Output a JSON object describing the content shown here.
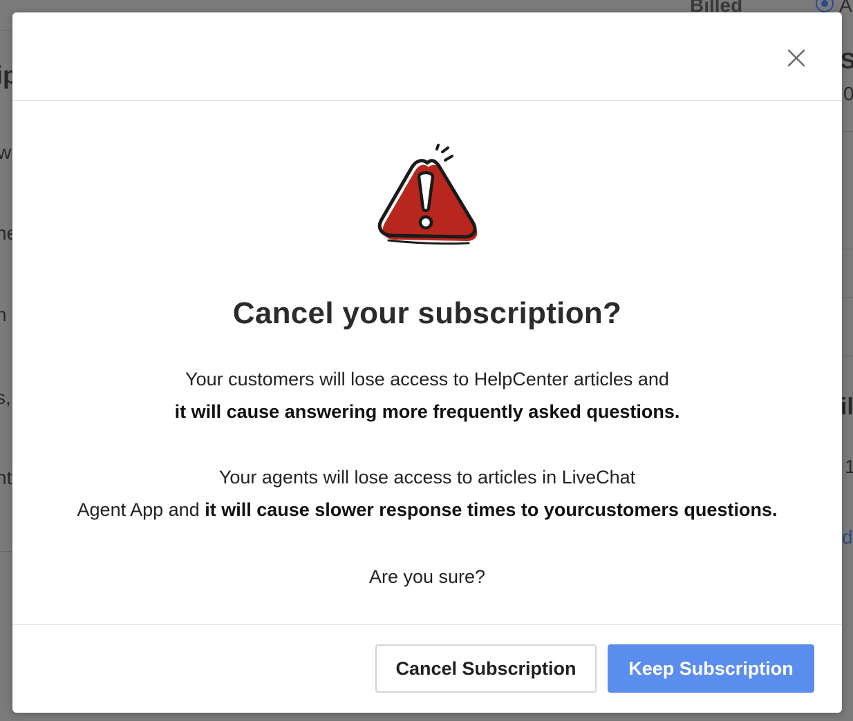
{
  "background": {
    "fragments": [
      "Billed",
      "A",
      "ip",
      "Su",
      "0",
      "w",
      "he",
      "n l",
      "s,",
      "il",
      "1",
      "nt",
      "d"
    ]
  },
  "modal": {
    "close_icon": "close-icon",
    "warning_icon": "warning-triangle-icon",
    "title": "Cancel your subscription?",
    "paragraph1": {
      "line1": "Your customers will lose access to HelpCenter articles and",
      "line2_bold": "it will cause answering more frequently asked questions."
    },
    "paragraph2": {
      "line1": "Your agents will lose access to articles in LiveChat",
      "line2_prefix": "Agent App and ",
      "line2_bold": "it will cause slower response times to yourcustomers questions."
    },
    "confirm_question": "Are you sure?",
    "buttons": {
      "cancel_label": "Cancel Subscription",
      "keep_label": "Keep Subscription"
    }
  },
  "colors": {
    "primary_button": "#5b8def",
    "warning_red": "#b8261e",
    "overlay": "#7b7b7b"
  }
}
